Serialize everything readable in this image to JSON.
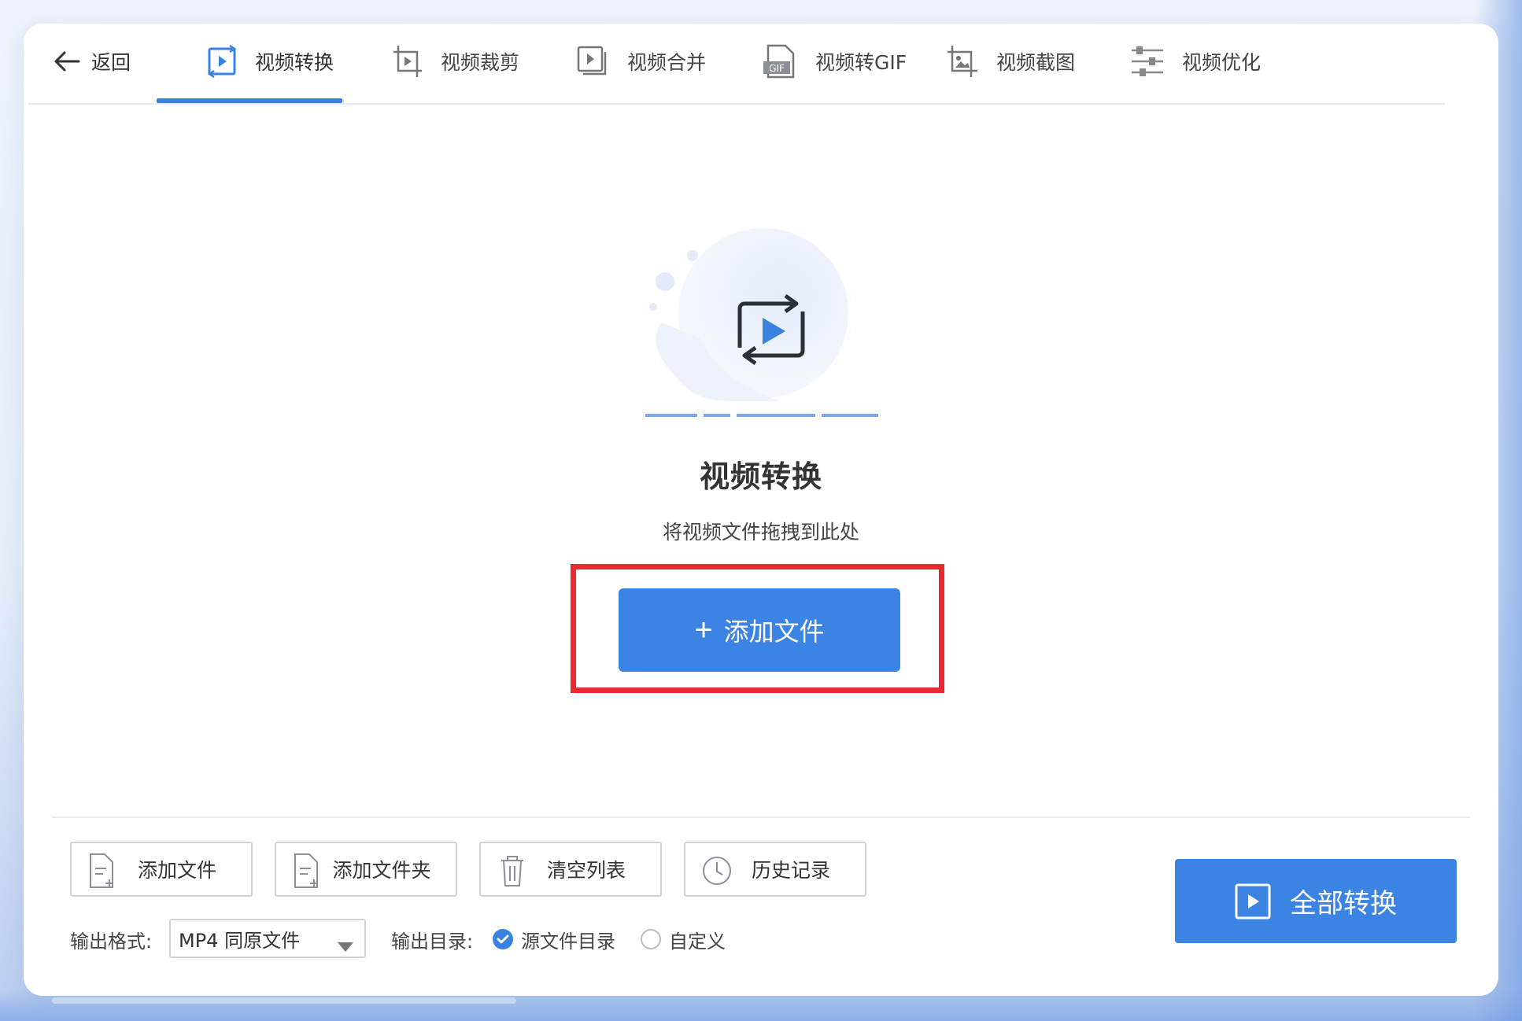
{
  "nav": {
    "back_label": "返回",
    "tabs": [
      {
        "label": "视频转换",
        "icon": "video-convert-icon",
        "active": true
      },
      {
        "label": "视频裁剪",
        "icon": "video-crop-icon",
        "active": false
      },
      {
        "label": "视频合并",
        "icon": "video-merge-icon",
        "active": false
      },
      {
        "label": "视频转GIF",
        "icon": "gif-icon",
        "active": false
      },
      {
        "label": "视频截图",
        "icon": "screenshot-icon",
        "active": false
      },
      {
        "label": "视频优化",
        "icon": "sliders-icon",
        "active": false
      }
    ]
  },
  "main": {
    "title": "视频转换",
    "subtitle": "将视频文件拖拽到此处",
    "add_button_label": "添加文件"
  },
  "toolbar": {
    "add_file": "添加文件",
    "add_folder": "添加文件夹",
    "clear_list": "清空列表",
    "history": "历史记录"
  },
  "output": {
    "format_label": "输出格式:",
    "format_value": "MP4 同原文件",
    "dir_label": "输出目录:",
    "dir_option_source": "源文件目录",
    "dir_option_custom": "自定义",
    "selected": "源文件目录"
  },
  "convert_all_label": "全部转换",
  "colors": {
    "accent": "#3b84e3",
    "highlight_border": "#ea2a2f"
  }
}
